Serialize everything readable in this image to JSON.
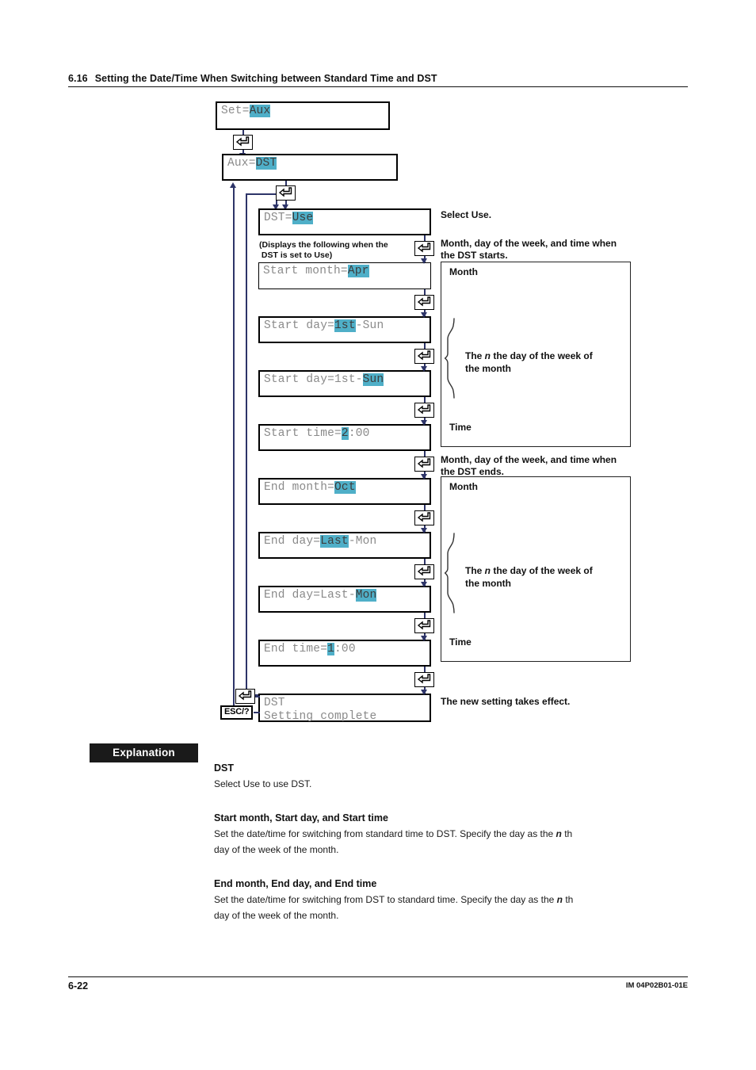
{
  "header": {
    "number": "6.16",
    "title": "Setting the Date/Time When Switching between Standard Time and DST"
  },
  "flow": {
    "note": "(Displays the following when the\n DST is set to Use)",
    "esc_key_label": "ESC/?",
    "steps": [
      {
        "id": "set-aux",
        "prefix": "Set=",
        "highlight": "Aux",
        "suffix": ""
      },
      {
        "id": "aux-dst",
        "prefix": "Aux=",
        "highlight": "DST",
        "suffix": ""
      },
      {
        "id": "dst-use",
        "prefix": "DST=",
        "highlight": "Use",
        "suffix": ""
      },
      {
        "id": "start-month",
        "prefix": "Start month=",
        "highlight": "Apr",
        "suffix": ""
      },
      {
        "id": "start-day-n",
        "prefix": "Start day=",
        "highlight": "1st",
        "suffix": "-Sun"
      },
      {
        "id": "start-day-w",
        "prefix": "Start day=1st-",
        "highlight": "Sun",
        "suffix": ""
      },
      {
        "id": "start-time",
        "prefix": "Start time=",
        "highlight": "2",
        "suffix": ":00"
      },
      {
        "id": "end-month",
        "prefix": "End month=",
        "highlight": "Oct",
        "suffix": ""
      },
      {
        "id": "end-day-n",
        "prefix": "End day=",
        "highlight": "Last",
        "suffix": "-Mon"
      },
      {
        "id": "end-day-w",
        "prefix": "End day=Last-",
        "highlight": "Mon",
        "suffix": ""
      },
      {
        "id": "end-time",
        "prefix": "End time=",
        "highlight": "1",
        "suffix": ":00"
      }
    ],
    "complete_box": {
      "line1": "DST",
      "line2": "Setting complete"
    },
    "callouts": {
      "select_use": "Select Use.",
      "dst_starts": "Month, day of the week, and time when\nthe DST starts.",
      "dst_ends": "Month, day of the week, and time when\nthe DST ends.",
      "takes_effect": "The new setting takes effect."
    },
    "annotation_box": {
      "month_label": "Month",
      "brace_text_1": "The ",
      "brace_text_n": "n",
      "brace_text_2": " the day of the week of",
      "brace_text_3": "the month",
      "time_label": "Time"
    },
    "colors": {
      "highlight": "#4FAFC8",
      "connector": "#2d3468",
      "lcd_text": "#8a8a8a"
    }
  },
  "explanation": {
    "tag": "Explanation",
    "sections": [
      {
        "title": "DST",
        "body": "Select Use to use DST."
      },
      {
        "title": "Start month, Start day, and Start time",
        "body_a": "Set the date/time for switching from standard time to DST. Specify the day as the ",
        "body_n": "n",
        "body_b": " th",
        "body_c": "day of the week of the month."
      },
      {
        "title": "End month, End day, and End time",
        "body_a": "Set the date/time for switching from DST to standard time. Specify the day as the ",
        "body_n": "n",
        "body_b": " th",
        "body_c": "day of the week of the month."
      }
    ]
  },
  "footer": {
    "page": "6-22",
    "doc_id": "IM 04P02B01-01E"
  }
}
